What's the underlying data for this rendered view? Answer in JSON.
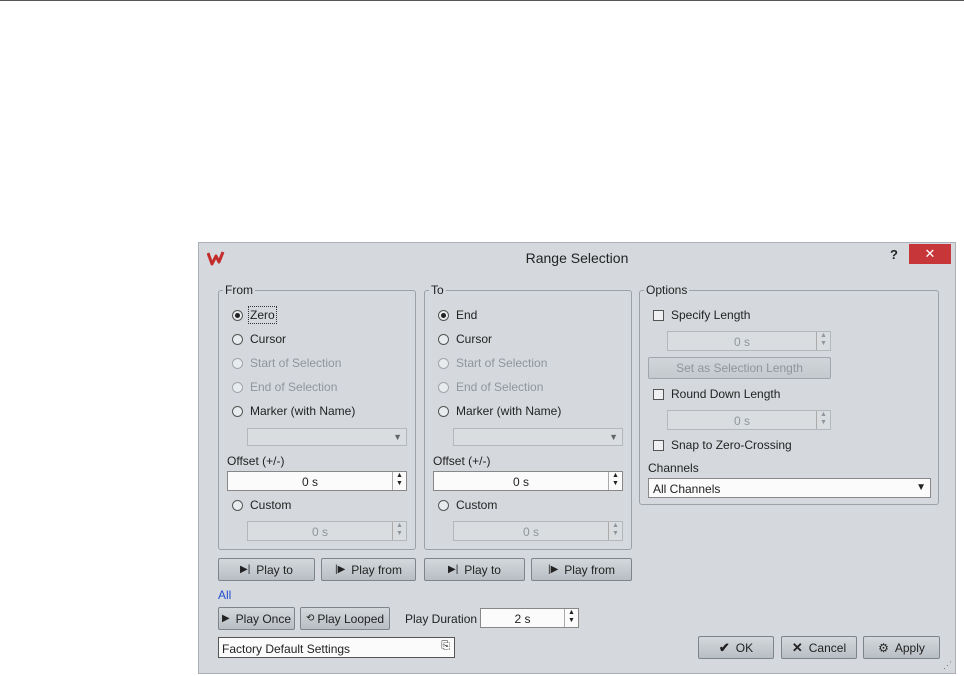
{
  "window": {
    "title": "Range Selection",
    "help_label": "?",
    "close_label": "✕"
  },
  "from_group": {
    "legend": "From",
    "options": [
      "Zero",
      "Cursor",
      "Start of Selection",
      "End of Selection",
      "Marker (with Name)"
    ],
    "selected": "Zero",
    "offset_label": "Offset (+/-)",
    "offset_value": "0 s",
    "custom_label": "Custom",
    "custom_value": "0 s"
  },
  "to_group": {
    "legend": "To",
    "options": [
      "End",
      "Cursor",
      "Start of Selection",
      "End of Selection",
      "Marker (with Name)"
    ],
    "selected": "End",
    "offset_label": "Offset (+/-)",
    "offset_value": "0 s",
    "custom_label": "Custom",
    "custom_value": "0 s"
  },
  "options_group": {
    "legend": "Options",
    "specify_length_label": "Specify Length",
    "specify_length_value": "0 s",
    "set_selection_length_label": "Set as Selection Length",
    "round_down_label": "Round Down Length",
    "round_down_value": "0 s",
    "snap_label": "Snap to Zero-Crossing",
    "channels_label": "Channels",
    "channels_value": "All Channels"
  },
  "play_buttons": {
    "play_to": "Play to",
    "play_from": "Play from"
  },
  "all_link": "All",
  "playback": {
    "play_once": "Play Once",
    "play_looped": "Play Looped",
    "duration_label": "Play Duration",
    "duration_value": "2 s"
  },
  "preset": {
    "value": "Factory Default Settings"
  },
  "footer": {
    "ok": "OK",
    "cancel": "Cancel",
    "apply": "Apply"
  },
  "colors": {
    "close": "#c7373a",
    "link": "#1f4fd1",
    "dialog_bg": "#d5d9dd"
  }
}
